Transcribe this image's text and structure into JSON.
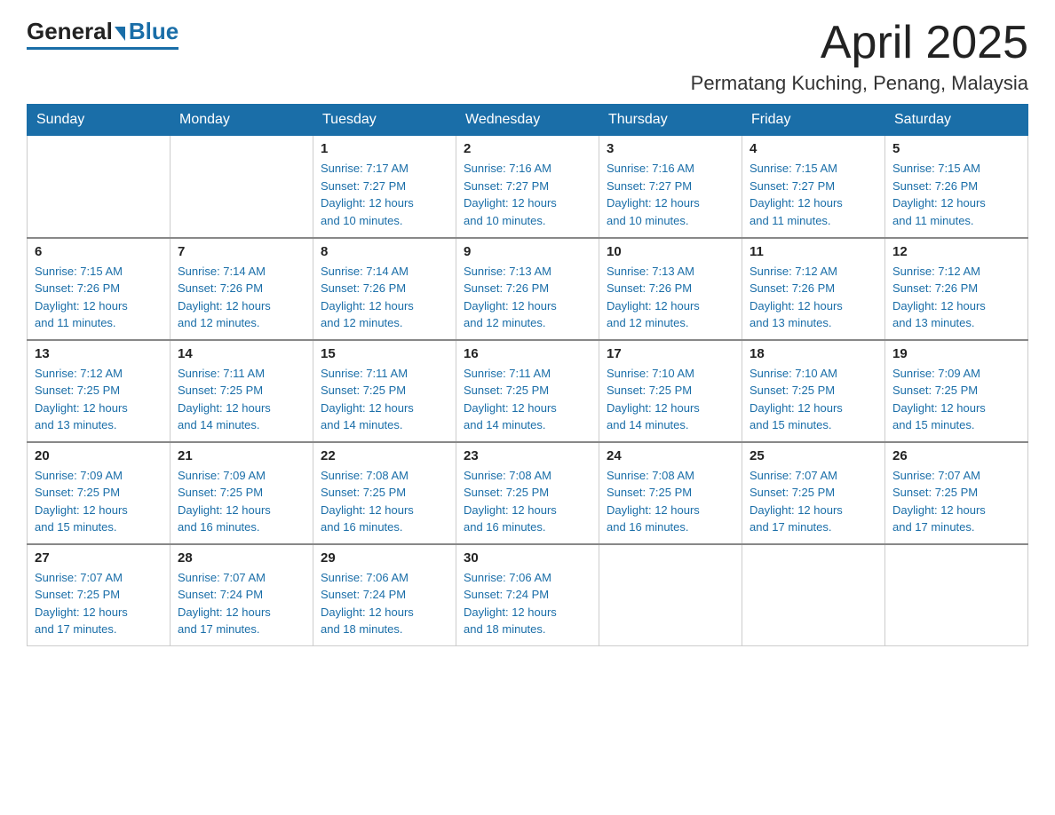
{
  "logo": {
    "general": "General",
    "blue": "Blue"
  },
  "title": "April 2025",
  "subtitle": "Permatang Kuching, Penang, Malaysia",
  "days_header": [
    "Sunday",
    "Monday",
    "Tuesday",
    "Wednesday",
    "Thursday",
    "Friday",
    "Saturday"
  ],
  "weeks": [
    [
      {
        "day": "",
        "info": ""
      },
      {
        "day": "",
        "info": ""
      },
      {
        "day": "1",
        "info": "Sunrise: 7:17 AM\nSunset: 7:27 PM\nDaylight: 12 hours\nand 10 minutes."
      },
      {
        "day": "2",
        "info": "Sunrise: 7:16 AM\nSunset: 7:27 PM\nDaylight: 12 hours\nand 10 minutes."
      },
      {
        "day": "3",
        "info": "Sunrise: 7:16 AM\nSunset: 7:27 PM\nDaylight: 12 hours\nand 10 minutes."
      },
      {
        "day": "4",
        "info": "Sunrise: 7:15 AM\nSunset: 7:27 PM\nDaylight: 12 hours\nand 11 minutes."
      },
      {
        "day": "5",
        "info": "Sunrise: 7:15 AM\nSunset: 7:26 PM\nDaylight: 12 hours\nand 11 minutes."
      }
    ],
    [
      {
        "day": "6",
        "info": "Sunrise: 7:15 AM\nSunset: 7:26 PM\nDaylight: 12 hours\nand 11 minutes."
      },
      {
        "day": "7",
        "info": "Sunrise: 7:14 AM\nSunset: 7:26 PM\nDaylight: 12 hours\nand 12 minutes."
      },
      {
        "day": "8",
        "info": "Sunrise: 7:14 AM\nSunset: 7:26 PM\nDaylight: 12 hours\nand 12 minutes."
      },
      {
        "day": "9",
        "info": "Sunrise: 7:13 AM\nSunset: 7:26 PM\nDaylight: 12 hours\nand 12 minutes."
      },
      {
        "day": "10",
        "info": "Sunrise: 7:13 AM\nSunset: 7:26 PM\nDaylight: 12 hours\nand 12 minutes."
      },
      {
        "day": "11",
        "info": "Sunrise: 7:12 AM\nSunset: 7:26 PM\nDaylight: 12 hours\nand 13 minutes."
      },
      {
        "day": "12",
        "info": "Sunrise: 7:12 AM\nSunset: 7:26 PM\nDaylight: 12 hours\nand 13 minutes."
      }
    ],
    [
      {
        "day": "13",
        "info": "Sunrise: 7:12 AM\nSunset: 7:25 PM\nDaylight: 12 hours\nand 13 minutes."
      },
      {
        "day": "14",
        "info": "Sunrise: 7:11 AM\nSunset: 7:25 PM\nDaylight: 12 hours\nand 14 minutes."
      },
      {
        "day": "15",
        "info": "Sunrise: 7:11 AM\nSunset: 7:25 PM\nDaylight: 12 hours\nand 14 minutes."
      },
      {
        "day": "16",
        "info": "Sunrise: 7:11 AM\nSunset: 7:25 PM\nDaylight: 12 hours\nand 14 minutes."
      },
      {
        "day": "17",
        "info": "Sunrise: 7:10 AM\nSunset: 7:25 PM\nDaylight: 12 hours\nand 14 minutes."
      },
      {
        "day": "18",
        "info": "Sunrise: 7:10 AM\nSunset: 7:25 PM\nDaylight: 12 hours\nand 15 minutes."
      },
      {
        "day": "19",
        "info": "Sunrise: 7:09 AM\nSunset: 7:25 PM\nDaylight: 12 hours\nand 15 minutes."
      }
    ],
    [
      {
        "day": "20",
        "info": "Sunrise: 7:09 AM\nSunset: 7:25 PM\nDaylight: 12 hours\nand 15 minutes."
      },
      {
        "day": "21",
        "info": "Sunrise: 7:09 AM\nSunset: 7:25 PM\nDaylight: 12 hours\nand 16 minutes."
      },
      {
        "day": "22",
        "info": "Sunrise: 7:08 AM\nSunset: 7:25 PM\nDaylight: 12 hours\nand 16 minutes."
      },
      {
        "day": "23",
        "info": "Sunrise: 7:08 AM\nSunset: 7:25 PM\nDaylight: 12 hours\nand 16 minutes."
      },
      {
        "day": "24",
        "info": "Sunrise: 7:08 AM\nSunset: 7:25 PM\nDaylight: 12 hours\nand 16 minutes."
      },
      {
        "day": "25",
        "info": "Sunrise: 7:07 AM\nSunset: 7:25 PM\nDaylight: 12 hours\nand 17 minutes."
      },
      {
        "day": "26",
        "info": "Sunrise: 7:07 AM\nSunset: 7:25 PM\nDaylight: 12 hours\nand 17 minutes."
      }
    ],
    [
      {
        "day": "27",
        "info": "Sunrise: 7:07 AM\nSunset: 7:25 PM\nDaylight: 12 hours\nand 17 minutes."
      },
      {
        "day": "28",
        "info": "Sunrise: 7:07 AM\nSunset: 7:24 PM\nDaylight: 12 hours\nand 17 minutes."
      },
      {
        "day": "29",
        "info": "Sunrise: 7:06 AM\nSunset: 7:24 PM\nDaylight: 12 hours\nand 18 minutes."
      },
      {
        "day": "30",
        "info": "Sunrise: 7:06 AM\nSunset: 7:24 PM\nDaylight: 12 hours\nand 18 minutes."
      },
      {
        "day": "",
        "info": ""
      },
      {
        "day": "",
        "info": ""
      },
      {
        "day": "",
        "info": ""
      }
    ]
  ]
}
